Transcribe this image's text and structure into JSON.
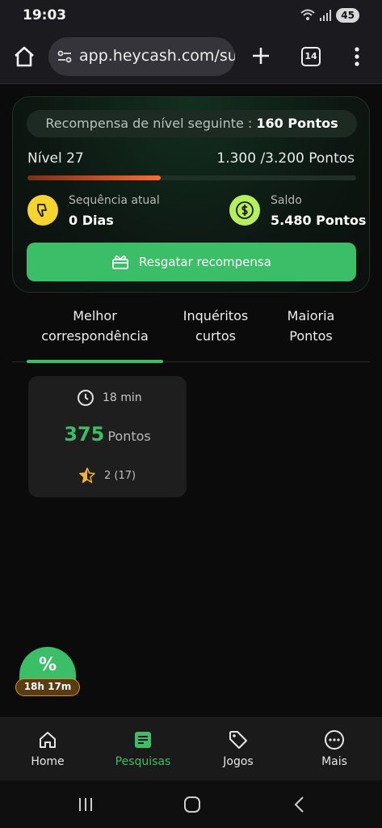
{
  "status_bar": {
    "time": "19:03",
    "battery": "45"
  },
  "browser": {
    "url": "app.heycash.com/su",
    "tab_count": "14"
  },
  "reward": {
    "next_reward_label": "Recompensa de nível seguinte :",
    "next_reward_points": "160 Pontos",
    "level": "Nível 27",
    "points_progress": "1.300 /3.200 Pontos",
    "progress_fraction": 0.406,
    "streak_label": "Sequência atual",
    "streak_value": "0 Dias",
    "balance_label": "Saldo",
    "balance_value": "5.480 Pontos",
    "claim_button": "Resgatar recompensa"
  },
  "tabs": [
    {
      "label_line1": "Melhor",
      "label_line2": "correspondência",
      "active": true
    },
    {
      "label_line1": "Inquéritos",
      "label_line2": "curtos",
      "active": false
    },
    {
      "label_line1": "Maioria",
      "label_line2": "Pontos",
      "active": false
    }
  ],
  "survey": {
    "duration": "18 min",
    "points": "375",
    "points_unit": "Pontos",
    "rating": "2 (17)"
  },
  "bonus": {
    "symbol": "%",
    "timer": "18h 17m"
  },
  "bottom_nav": [
    {
      "label": "Home",
      "icon": "home-icon"
    },
    {
      "label": "Pesquisas",
      "icon": "survey-icon",
      "active": true
    },
    {
      "label": "Jogos",
      "icon": "tag-icon"
    },
    {
      "label": "Mais",
      "icon": "more-icon"
    }
  ],
  "colors": {
    "accent": "#3cbd68",
    "background": "#0b0b0b",
    "progress": "#ff6a33",
    "streak_icon": "#f5d431",
    "balance_icon": "#b6ef5e"
  }
}
